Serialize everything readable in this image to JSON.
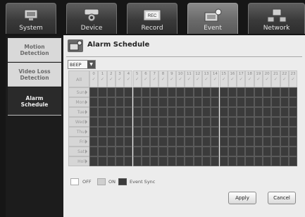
{
  "tabs": [
    {
      "label": "System",
      "icon": "monitor-icon",
      "active": false
    },
    {
      "label": "Device",
      "icon": "camera-icon",
      "active": false
    },
    {
      "label": "Record",
      "icon": "record-icon",
      "active": false
    },
    {
      "label": "Event",
      "icon": "event-icon",
      "active": true
    },
    {
      "label": "Network",
      "icon": "network-icon",
      "active": false
    }
  ],
  "sidebar": {
    "items": [
      {
        "label_line1": "Motion",
        "label_line2": "Detection",
        "active": false
      },
      {
        "label_line1": "Video Loss",
        "label_line2": "Detection",
        "active": false
      },
      {
        "label_line1": "Alarm",
        "label_line2": "Schedule",
        "active": true
      }
    ]
  },
  "main": {
    "title": "Alarm Schedule",
    "sound_select": {
      "value": "BEEP"
    },
    "schedule": {
      "all_label": "All",
      "hours": [
        "0",
        "1",
        "2",
        "3",
        "4",
        "5",
        "6",
        "7",
        "8",
        "9",
        "10",
        "11",
        "12",
        "13",
        "14",
        "15",
        "16",
        "17",
        "18",
        "19",
        "20",
        "21",
        "22",
        "23"
      ],
      "days": [
        "Sun",
        "Mon",
        "Tue",
        "Wed",
        "Thu",
        "Fri",
        "Sat",
        "Hol"
      ]
    },
    "legend": {
      "off": "OFF",
      "on": "ON",
      "event_sync": "Event Sync"
    },
    "buttons": {
      "apply": "Apply",
      "cancel": "Cancel"
    }
  },
  "colors": {
    "off": "#ffffff",
    "on": "#cfcfcf",
    "event_sync": "#3b3b3b"
  }
}
